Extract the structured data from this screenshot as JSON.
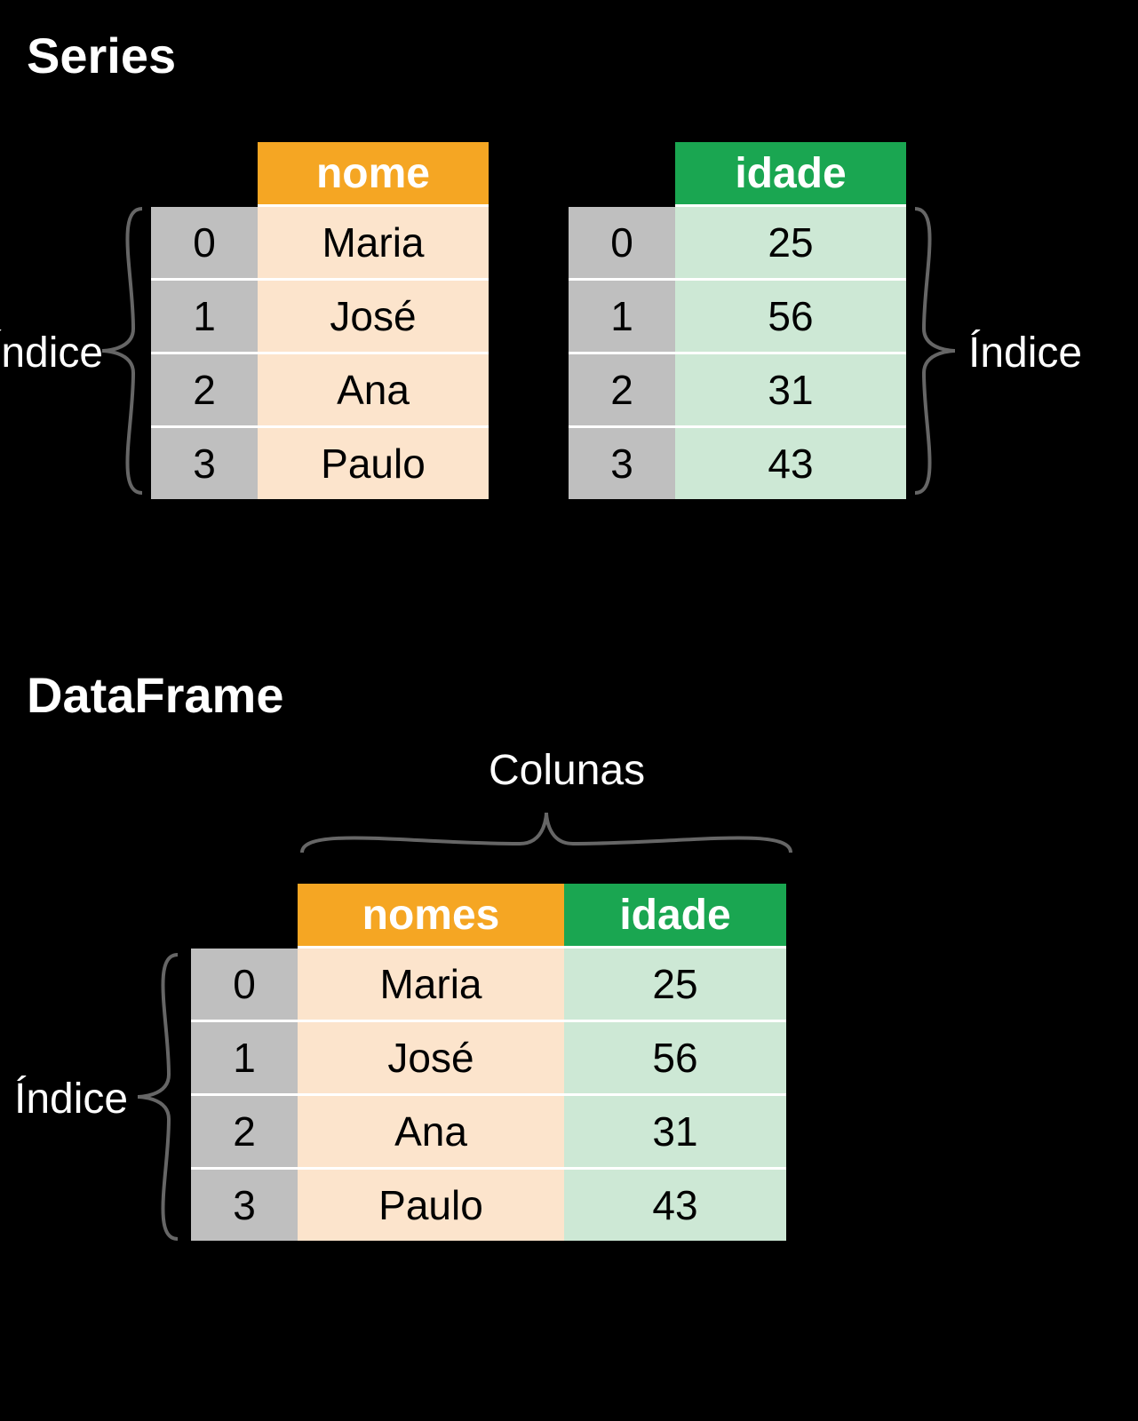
{
  "titles": {
    "series": "Series",
    "dataframe": "DataFrame"
  },
  "labels": {
    "indice": "Índice",
    "colunas": "Colunas"
  },
  "series_nome": {
    "header": "nome",
    "rows": [
      {
        "index": "0",
        "value": "Maria"
      },
      {
        "index": "1",
        "value": "José"
      },
      {
        "index": "2",
        "value": "Ana"
      },
      {
        "index": "3",
        "value": "Paulo"
      }
    ]
  },
  "series_idade": {
    "header": "idade",
    "rows": [
      {
        "index": "0",
        "value": "25"
      },
      {
        "index": "1",
        "value": "56"
      },
      {
        "index": "2",
        "value": "31"
      },
      {
        "index": "3",
        "value": "43"
      }
    ]
  },
  "dataframe": {
    "columns": [
      "nomes",
      "idade"
    ],
    "rows": [
      {
        "index": "0",
        "nomes": "Maria",
        "idade": "25"
      },
      {
        "index": "1",
        "nomes": "José",
        "idade": "56"
      },
      {
        "index": "2",
        "nomes": "Ana",
        "idade": "31"
      },
      {
        "index": "3",
        "nomes": "Paulo",
        "idade": "43"
      }
    ]
  },
  "colors": {
    "orange": "#f5a623",
    "orange_light": "#fce4cc",
    "green": "#1aa651",
    "green_light": "#cde8d5",
    "grey": "#bfbfbf"
  }
}
